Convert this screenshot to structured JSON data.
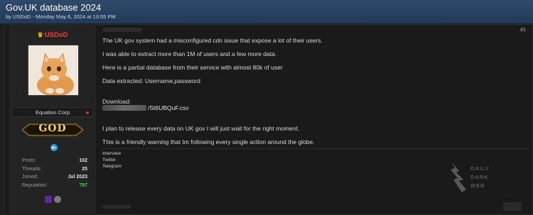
{
  "thread": {
    "title": "Gov.UK database 2024",
    "meta": "by USDoD - Monday May 6, 2024 at 10:55 PM"
  },
  "author": {
    "username": "USDoD",
    "user_title": "Equation Corp.",
    "rank": "GOD",
    "stats": [
      {
        "label": "Posts:",
        "value": "102"
      },
      {
        "label": "Threads:",
        "value": "25"
      },
      {
        "label": "Joined:",
        "value": "Jul 2023"
      },
      {
        "label": "Reputation:",
        "value": "797"
      }
    ],
    "colors": {
      "username": "#ff3b30",
      "reputation": "#3bd13b"
    }
  },
  "post": {
    "number": "#1",
    "lines": [
      "The UK gov system had a misconfigured cdn issue that expose a lot of their users.",
      "I was able to extract more than 1M of users and a few more data.",
      "Here is a partial database from their service with almost 80k of user",
      "Data extracted: Username,password"
    ],
    "download_label": "Download:",
    "download_file": "/St6UBQuF.csv",
    "closing_lines": [
      "I plan to release every data on UK gov I will just wait for the right moment.",
      "This is a friendly warning that Im following every single action around the globe."
    ],
    "signature": [
      "Interview",
      "Twitter",
      "Telegram"
    ]
  },
  "watermark": {
    "lines": [
      "DAILY",
      "DARK",
      "WEB"
    ]
  }
}
